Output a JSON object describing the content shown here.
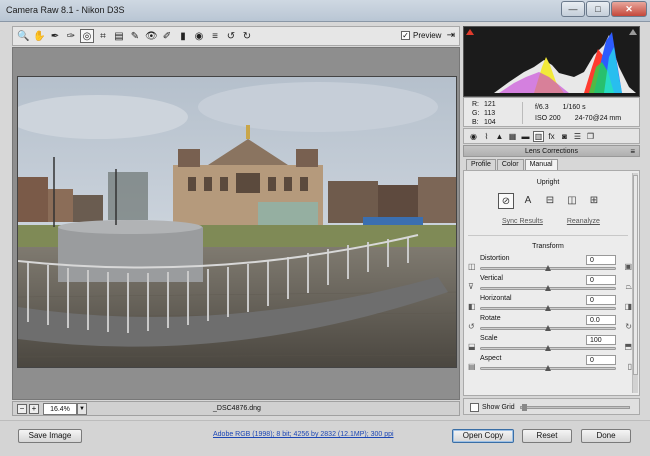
{
  "window": {
    "title": "Camera Raw 8.1  -  Nikon D3S",
    "minimize": "—",
    "maximize": "□",
    "close": "✕"
  },
  "toolbar": {
    "tools": [
      {
        "name": "zoom-tool-icon",
        "glyph": "🔍"
      },
      {
        "name": "hand-tool-icon",
        "glyph": "✋"
      },
      {
        "name": "white-balance-tool-icon",
        "glyph": "✒"
      },
      {
        "name": "color-sampler-tool-icon",
        "glyph": "✑"
      },
      {
        "name": "targeted-adjustment-tool-icon",
        "glyph": "◎"
      },
      {
        "name": "crop-tool-icon",
        "glyph": "⌗"
      },
      {
        "name": "straighten-tool-icon",
        "glyph": "▤"
      },
      {
        "name": "spot-removal-tool-icon",
        "glyph": "✎"
      },
      {
        "name": "red-eye-tool-icon",
        "glyph": "👁"
      },
      {
        "name": "adjustment-brush-icon",
        "glyph": "✐"
      },
      {
        "name": "graduated-filter-icon",
        "glyph": "▮"
      },
      {
        "name": "radial-filter-icon",
        "glyph": "◉"
      },
      {
        "name": "preferences-icon",
        "glyph": "≡"
      },
      {
        "name": "rotate-ccw-icon",
        "glyph": "↺"
      },
      {
        "name": "rotate-cw-icon",
        "glyph": "↻"
      }
    ],
    "preview_label": "Preview",
    "preview_checked": "✓",
    "export_glyph": "⇥"
  },
  "bottom": {
    "zoom_out": "−",
    "zoom_in": "+",
    "zoom_value": "16.4%",
    "zoom_drop": "▼",
    "filename": "_DSC4876.dng"
  },
  "info": {
    "r_label": "R:",
    "r_value": "121",
    "g_label": "G:",
    "g_value": "113",
    "b_label": "B:",
    "b_value": "104",
    "aperture": "f/6.3",
    "shutter": "1/160 s",
    "iso": "ISO 200",
    "lens": "24-70@24 mm"
  },
  "panel_icons": [
    {
      "name": "basic-panel-icon",
      "glyph": "◉"
    },
    {
      "name": "tone-curve-panel-icon",
      "glyph": "⌇"
    },
    {
      "name": "detail-panel-icon",
      "glyph": "▲"
    },
    {
      "name": "hsl-panel-icon",
      "glyph": "▦"
    },
    {
      "name": "split-toning-panel-icon",
      "glyph": "▬"
    },
    {
      "name": "lens-corrections-panel-icon",
      "glyph": "▥"
    },
    {
      "name": "effects-panel-icon",
      "glyph": "fx"
    },
    {
      "name": "camera-calibration-panel-icon",
      "glyph": "◙"
    },
    {
      "name": "presets-panel-icon",
      "glyph": "☰"
    },
    {
      "name": "snapshots-panel-icon",
      "glyph": "❐"
    }
  ],
  "section": {
    "title": "Lens Corrections",
    "menu": "≡"
  },
  "tabs": [
    {
      "name": "tab-profile",
      "label": "Profile"
    },
    {
      "name": "tab-color",
      "label": "Color"
    },
    {
      "name": "tab-manual",
      "label": "Manual"
    }
  ],
  "upright": {
    "label": "Upright",
    "buttons": [
      {
        "name": "upright-off-icon",
        "glyph": "⊘"
      },
      {
        "name": "upright-auto-icon",
        "glyph": "A"
      },
      {
        "name": "upright-level-icon",
        "glyph": "⊟"
      },
      {
        "name": "upright-vertical-icon",
        "glyph": "◫"
      },
      {
        "name": "upright-full-icon",
        "glyph": "⊞"
      }
    ],
    "sync": "Sync Results",
    "reanalyze": "Reanalyze"
  },
  "transform": {
    "label": "Transform",
    "sliders": [
      {
        "name": "distortion",
        "label": "Distortion",
        "value": "0",
        "licon": "◫",
        "ricon": "▣",
        "pos": 0.5
      },
      {
        "name": "vertical",
        "label": "Vertical",
        "value": "0",
        "licon": "⊽",
        "ricon": "⏢",
        "pos": 0.5
      },
      {
        "name": "horizontal",
        "label": "Horizontal",
        "value": "0",
        "licon": "◧",
        "ricon": "◨",
        "pos": 0.5
      },
      {
        "name": "rotate",
        "label": "Rotate",
        "value": "0.0",
        "licon": "↺",
        "ricon": "↻",
        "pos": 0.5
      },
      {
        "name": "scale",
        "label": "Scale",
        "value": "100",
        "licon": "⬓",
        "ricon": "⬒",
        "pos": 0.5
      },
      {
        "name": "aspect",
        "label": "Aspect",
        "value": "0",
        "licon": "▤",
        "ricon": "▯",
        "pos": 0.5
      }
    ]
  },
  "grid": {
    "label": "Show Grid"
  },
  "footer": {
    "save": "Save Image",
    "workflow": "Adobe RGB (1998); 8 bit; 4256 by 2832 (12.1MP); 300 ppi",
    "open": "Open Copy",
    "reset": "Reset",
    "done": "Done"
  }
}
